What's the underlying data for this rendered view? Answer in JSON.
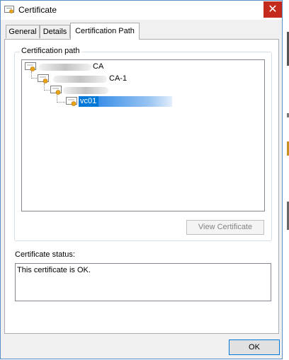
{
  "window": {
    "title": "Certificate",
    "close_glyph": "✕"
  },
  "tabs": [
    {
      "label": "General",
      "active": false
    },
    {
      "label": "Details",
      "active": false
    },
    {
      "label": "Certification Path",
      "active": true
    }
  ],
  "certification_path": {
    "group_label": "Certification path",
    "nodes": [
      {
        "label": "CA",
        "level": 0,
        "selected": false
      },
      {
        "label": "CA-1",
        "level": 1,
        "selected": false
      },
      {
        "label": "",
        "level": 2,
        "selected": false
      },
      {
        "label": "vc01",
        "level": 3,
        "selected": true
      }
    ],
    "icon": "certificate-icon"
  },
  "view_certificate_label": "View Certificate",
  "status": {
    "label": "Certificate status:",
    "text": "This certificate is OK."
  },
  "ok_label": "OK",
  "colors": {
    "selection": "#0078d7",
    "close": "#c42b1c",
    "border": "#5a8fc7"
  }
}
